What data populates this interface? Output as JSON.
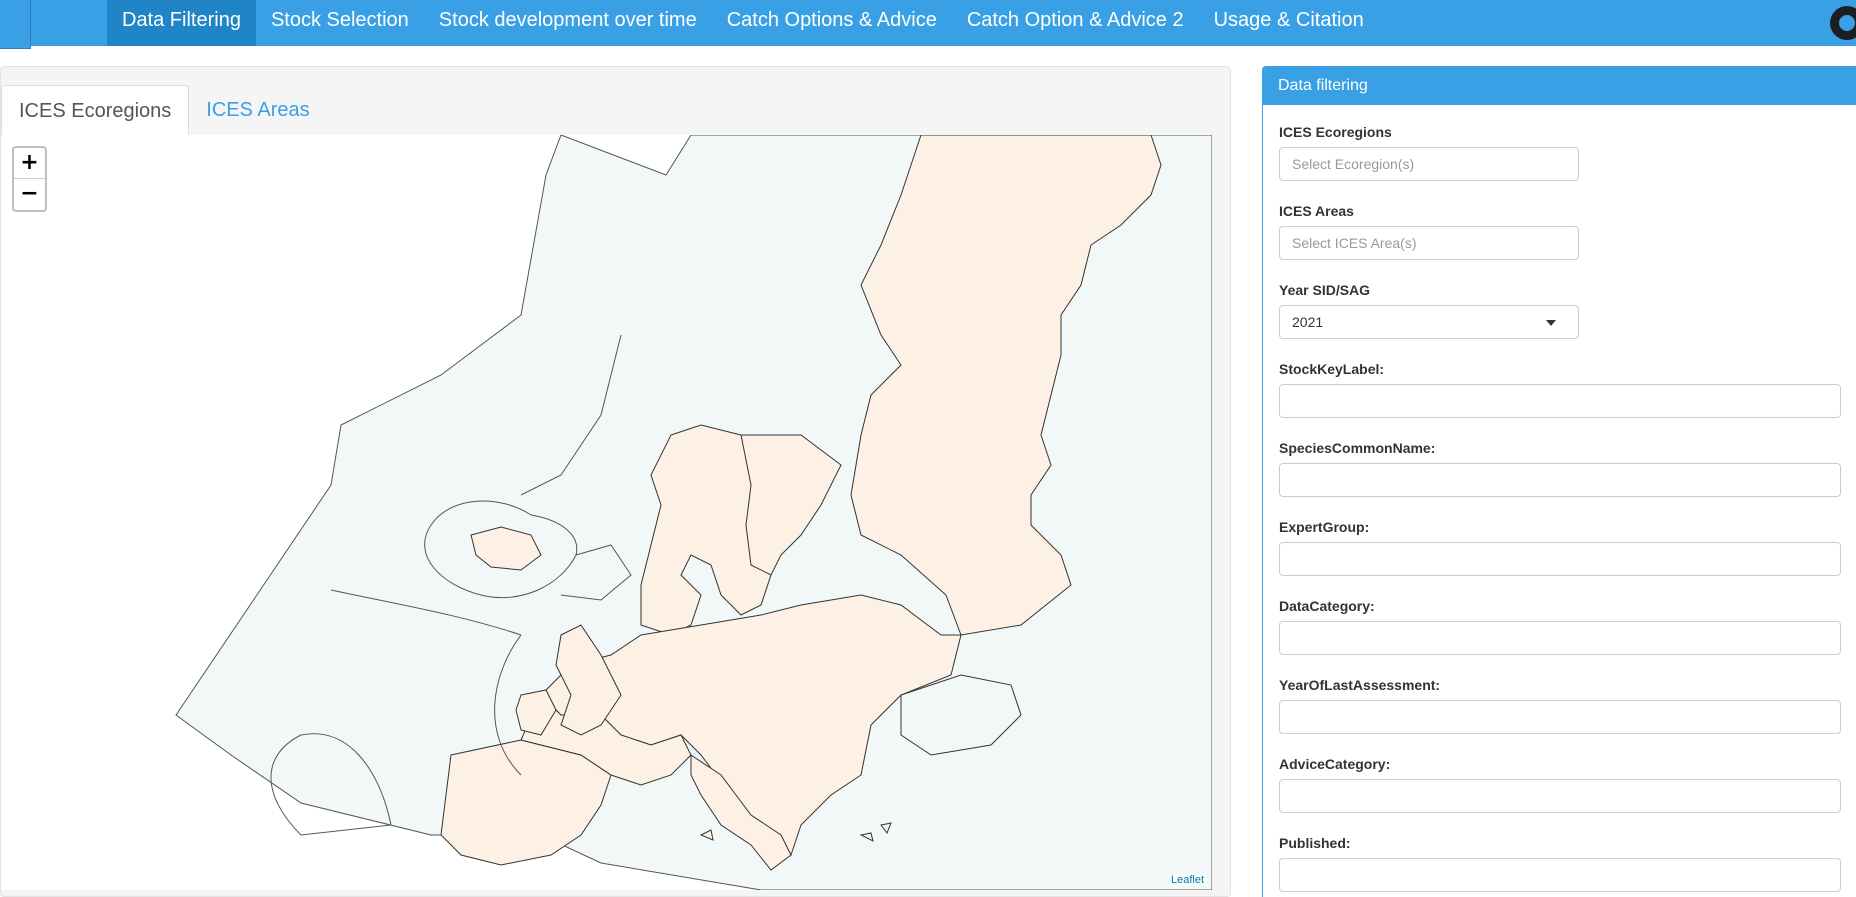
{
  "navbar": {
    "items": [
      "Data Filtering",
      "Stock Selection",
      "Stock development over time",
      "Catch Options & Advice",
      "Catch Option & Advice 2",
      "Usage & Citation"
    ],
    "active_index": 0
  },
  "tabs": {
    "ecoregions": "ICES Ecoregions",
    "areas": "ICES Areas"
  },
  "map": {
    "zoom_in": "+",
    "zoom_out": "−",
    "attribution": "Leaflet",
    "sea_color": "#f2f8f8",
    "land_color": "#fdf0e4",
    "border_color": "#333333"
  },
  "panel": {
    "heading": "Data filtering",
    "ecoregions_label": "ICES Ecoregions",
    "ecoregions_placeholder": "Select Ecoregion(s)",
    "areas_label": "ICES Areas",
    "areas_placeholder": "Select ICES Area(s)",
    "year_label": "Year SID/SAG",
    "year_value": "2021",
    "stockkeylabel_label": "StockKeyLabel:",
    "species_label": "SpeciesCommonName:",
    "expertgroup_label": "ExpertGroup:",
    "datacategory_label": "DataCategory:",
    "yearlast_label": "YearOfLastAssessment:",
    "advicecategory_label": "AdviceCategory:",
    "published_label": "Published:"
  }
}
